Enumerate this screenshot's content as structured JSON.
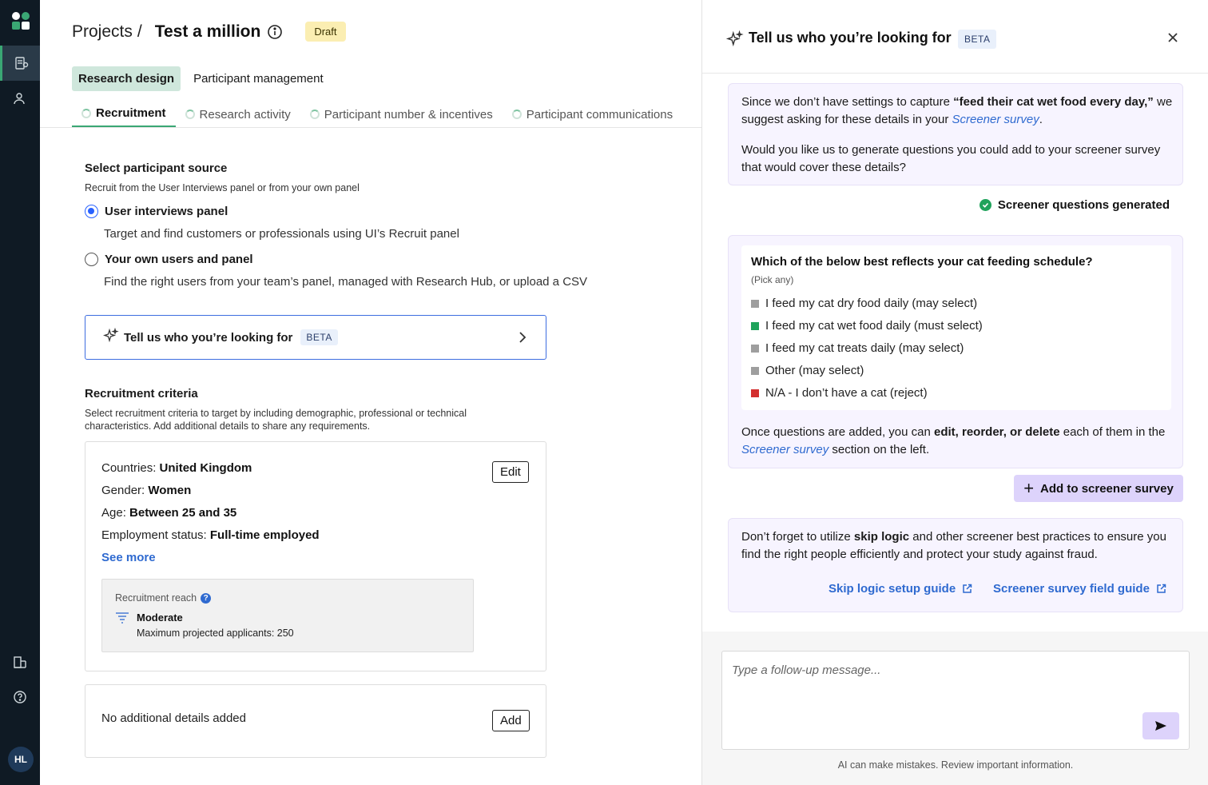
{
  "rail": {
    "avatar_initials": "HL"
  },
  "header": {
    "breadcrumb_root": "Projects",
    "breadcrumb_sep": "/",
    "project_title": "Test a million",
    "status_badge": "Draft"
  },
  "top_tabs": [
    {
      "label": "Research design",
      "active": true
    },
    {
      "label": "Participant management",
      "active": false
    }
  ],
  "sub_tabs": [
    {
      "label": "Recruitment",
      "active": true
    },
    {
      "label": "Research activity",
      "active": false
    },
    {
      "label": "Participant number & incentives",
      "active": false
    },
    {
      "label": "Participant communications",
      "active": false
    }
  ],
  "source": {
    "title": "Select participant source",
    "description": "Recruit from the User Interviews panel or from your own panel",
    "options": [
      {
        "label": "User interviews panel",
        "description": "Target and find customers or professionals using UI’s Recruit panel",
        "selected": true
      },
      {
        "label": "Your own users and panel",
        "description": "Find the right users from your team’s panel, managed with Research Hub, or upload a CSV",
        "selected": false
      }
    ]
  },
  "cta": {
    "label": "Tell us who you’re looking for",
    "badge": "BETA"
  },
  "criteria": {
    "title": "Recruitment criteria",
    "description_1": "Select recruitment criteria to target by including demographic, professional or technical",
    "description_2": "characteristics. Add additional details to share any requirements.",
    "edit_label": "Edit",
    "items": [
      {
        "key": "Countries:",
        "value": "United Kingdom"
      },
      {
        "key": "Gender:",
        "value": "Women"
      },
      {
        "key": "Age:",
        "value": "Between 25 and 35"
      },
      {
        "key": "Employment status:",
        "value": "Full-time employed"
      }
    ],
    "see_more": "See more",
    "reach": {
      "label": "Recruitment reach",
      "level": "Moderate",
      "max_label": "Maximum projected applicants:",
      "max_value": "250"
    }
  },
  "additional": {
    "text": "No additional details added",
    "add_label": "Add"
  },
  "panel": {
    "title": "Tell us who you’re looking for",
    "badge": "BETA",
    "msg1": {
      "p1_a": "Since we don’t have settings to capture ",
      "p1_bold": "“feed their cat wet food every day,”",
      "p1_b": " we",
      "p1_c": "suggest asking for these details in your ",
      "p1_link": "Screener survey",
      "p1_d": ".",
      "p2_line1": "Would you like us to generate questions you could add to your screener survey",
      "p2_line2": "that would cover these details?"
    },
    "generated": "Screener questions generated",
    "question": {
      "title": "Which of the below best reflects your cat feeding schedule?",
      "hint": "(Pick any)",
      "options": [
        {
          "label": "I feed my cat dry food daily (may select)",
          "color": "#9e9e9e"
        },
        {
          "label": "I feed my cat wet food daily (must select)",
          "color": "#1fa35b"
        },
        {
          "label": "I feed my cat treats daily (may select)",
          "color": "#9e9e9e"
        },
        {
          "label": "Other (may select)",
          "color": "#9e9e9e"
        },
        {
          "label": "N/A - I don’t have a cat (reject)",
          "color": "#d32f2f"
        }
      ],
      "after_a": "Once questions are added, you can ",
      "after_bold": "edit, reorder, or delete",
      "after_b": " each of them in the",
      "after_link": "Screener survey",
      "after_c": " section on the left."
    },
    "add_button": "Add to screener survey",
    "tip": {
      "a": "Don’t forget to utilize ",
      "bold": "skip logic",
      "b": " and other screener best practices to ensure you",
      "line2": "find the right people efficiently and protect your study against fraud.",
      "link1": "Skip logic setup guide",
      "link2": "Screener survey field guide"
    },
    "composer_placeholder": "Type a follow-up message...",
    "disclaimer": "AI can make mistakes. Review important information."
  }
}
